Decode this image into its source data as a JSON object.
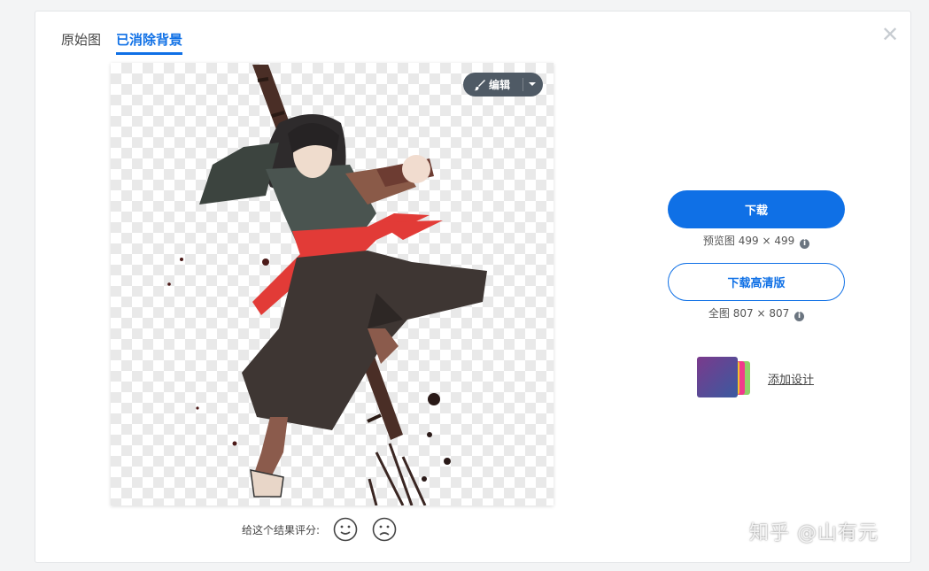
{
  "tabs": [
    {
      "label": "原始图",
      "active": false
    },
    {
      "label": "已消除背景",
      "active": true
    }
  ],
  "close_icon": "close-icon",
  "edit_button": {
    "label": "编辑",
    "icon": "brush-icon"
  },
  "rating": {
    "label": "给这个结果评分:",
    "icons": [
      "smile-icon",
      "frown-icon"
    ]
  },
  "download": {
    "label": "下载",
    "preview_label": "预览图",
    "preview_size": "499 × 499"
  },
  "download_hd": {
    "label": "下载高清版",
    "full_label": "全图",
    "full_size": "807 × 807"
  },
  "add_design": {
    "label": "添加设计"
  },
  "watermark": "知乎 @山有元",
  "colors": {
    "accent": "#0f70e6",
    "edit_bg": "#4f5a65",
    "sash_red": "#e23b37"
  }
}
